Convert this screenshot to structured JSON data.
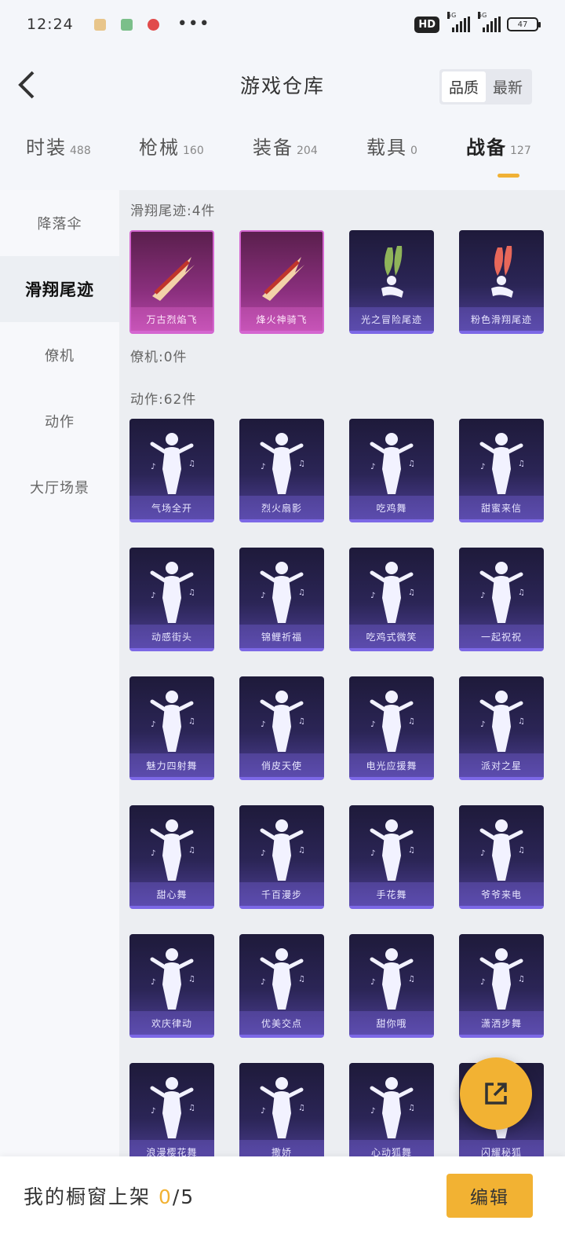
{
  "status_bar": {
    "time": "12:24",
    "hd_label": "HD",
    "signal_tag_1": "5G",
    "signal_tag_2": "5G",
    "battery": "47",
    "more": "•••"
  },
  "header": {
    "title": "游戏仓库",
    "sort_options": [
      "品质",
      "最新"
    ],
    "active_sort": "品质"
  },
  "tabs": [
    {
      "name": "时装",
      "count": "488"
    },
    {
      "name": "枪械",
      "count": "160"
    },
    {
      "name": "装备",
      "count": "204"
    },
    {
      "name": "载具",
      "count": "0"
    },
    {
      "name": "战备",
      "count": "127"
    }
  ],
  "active_tab": "战备",
  "sidebar": {
    "items": [
      "降落伞",
      "滑翔尾迹",
      "僚机",
      "动作",
      "大厅场景"
    ],
    "active": "滑翔尾迹"
  },
  "sections": [
    {
      "title": "滑翔尾迹:4件",
      "items": [
        "万古烈焰飞",
        "烽火神骑飞",
        "光之冒险尾迹",
        "粉色滑翔尾迹"
      ]
    },
    {
      "title": "僚机:0件",
      "items": []
    },
    {
      "title": "动作:62件",
      "items": [
        "气场全开",
        "烈火扇影",
        "吃鸡舞",
        "甜蜜来信",
        "动感街头",
        "锦鲤祈福",
        "吃鸡式微笑",
        "一起祝祝",
        "魅力四射舞",
        "俏皮天使",
        "电光应援舞",
        "派对之星",
        "甜心舞",
        "千百漫步",
        "手花舞",
        "爷爷来电",
        "欢庆律动",
        "优美交点",
        "甜你哦",
        "潇洒步舞",
        "浪漫樱花舞",
        "撒娇",
        "心动狐舞",
        "闪耀秘狐"
      ]
    }
  ],
  "bottom_bar": {
    "label": "我的橱窗上架",
    "current": "0",
    "total": "/5",
    "edit_button": "编辑"
  },
  "colors": {
    "accent": "#f2b233",
    "card_dark": "#2b2556",
    "card_purple": "#8a2f7d",
    "card_border": "#7c68e6"
  }
}
